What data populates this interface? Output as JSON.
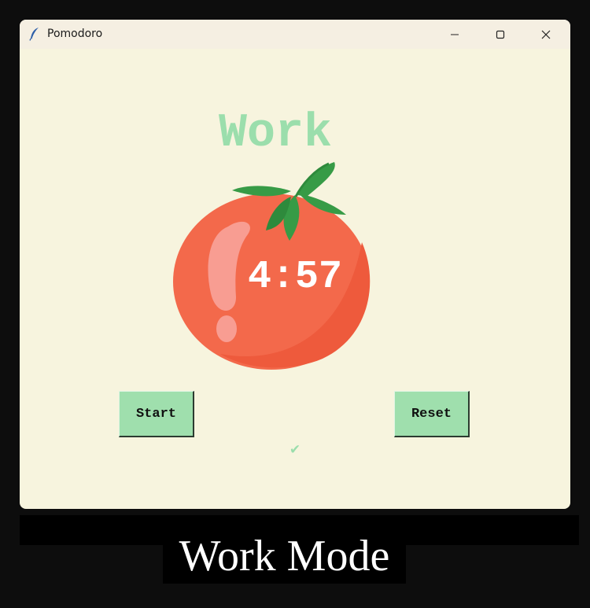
{
  "window": {
    "title": "Pomodoro",
    "app_icon": "feather-icon",
    "controls": {
      "minimize": "minimize-icon",
      "maximize": "maximize-icon",
      "close": "close-icon"
    }
  },
  "app": {
    "mode_label": "Work",
    "timer": "4:57",
    "start_label": "Start",
    "reset_label": "Reset",
    "checkmarks": "✔",
    "image": "tomato-icon"
  },
  "caption": "Work Mode",
  "colors": {
    "background": "#f7f4de",
    "accent_green": "#9bdeac",
    "tomato_red": "#f26849",
    "leaf_green": "#379b46"
  }
}
